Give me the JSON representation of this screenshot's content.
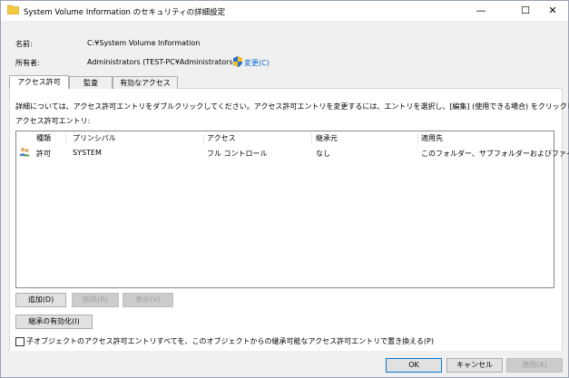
{
  "window": {
    "title": "System Volume Information のセキュリティの詳細設定",
    "minimize": "—",
    "maximize": "☐",
    "close": "✕"
  },
  "header": {
    "name_label": "名前:",
    "name_value": "C:¥System Volume Information",
    "owner_label": "所有者:",
    "owner_value": "Administrators (TEST-PC¥Administrators)",
    "change_link": "変更(C)"
  },
  "tabs": [
    "アクセス許可",
    "監査",
    "有効なアクセス"
  ],
  "instructions": "詳細については、アクセス許可エントリをダブルクリックしてください。アクセス許可エントリを変更するには、エントリを選択し、[編集] (使用できる場合) をクリックします。",
  "entries_label": "アクセス許可エントリ:",
  "columns": [
    "種類",
    "プリンシパル",
    "アクセス",
    "継承元",
    "適用先"
  ],
  "rows": [
    {
      "type": "許可",
      "principal": "SYSTEM",
      "access": "フル コントロール",
      "inherited": "なし",
      "applies_to": "このフォルダー、サブフォルダーおよびファイル"
    }
  ],
  "buttons": {
    "add": "追加(D)",
    "remove": "削除(R)",
    "view": "表示(V)",
    "enable_inheritance": "継承の有効化(I)",
    "ok": "OK",
    "cancel": "キャンセル",
    "apply": "適用(A)"
  },
  "replace_checkbox_label": "子オブジェクトのアクセス許可エントリすべてを、このオブジェクトからの継承可能なアクセス許可エントリで置き換える(P)"
}
